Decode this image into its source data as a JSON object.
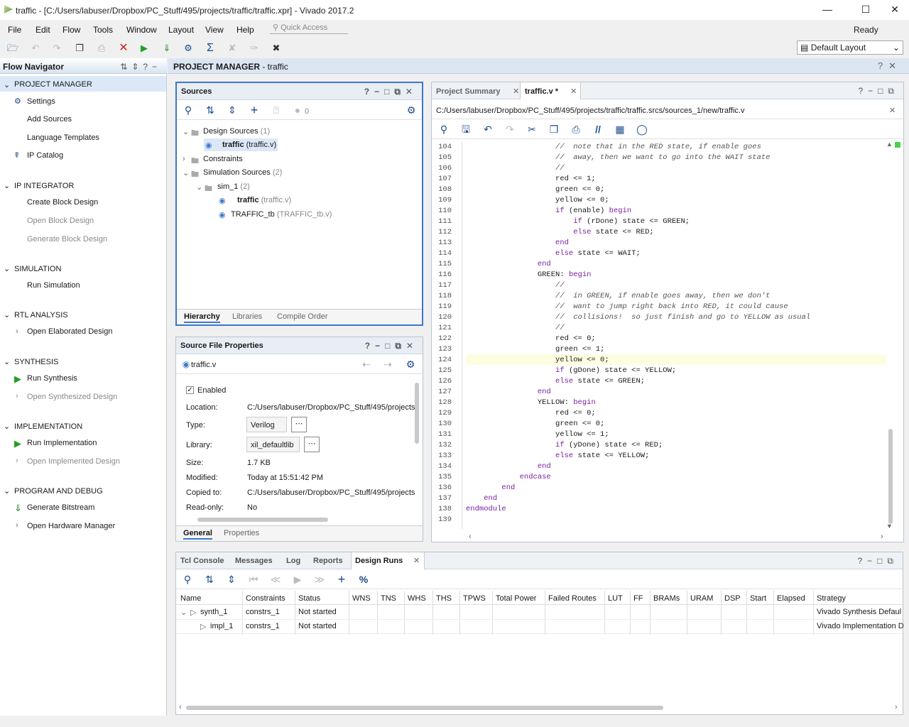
{
  "window": {
    "title": "traffic - [C:/Users/labuser/Dropbox/PC_Stuff/495/projects/traffic/traffic.xpr] - Vivado 2017.2"
  },
  "menu": [
    "File",
    "Edit",
    "Flow",
    "Tools",
    "Window",
    "Layout",
    "View",
    "Help"
  ],
  "quick_access": "Quick Access",
  "status": "Ready",
  "layout_select": "Default Layout",
  "flow_navigator": {
    "title": "Flow Navigator",
    "sections": [
      {
        "label": "PROJECT MANAGER",
        "items": [
          "Settings",
          "Add Sources",
          "Language Templates",
          "IP Catalog"
        ]
      },
      {
        "label": "IP INTEGRATOR",
        "items": [
          "Create Block Design",
          "Open Block Design",
          "Generate Block Design"
        ]
      },
      {
        "label": "SIMULATION",
        "items": [
          "Run Simulation"
        ]
      },
      {
        "label": "RTL ANALYSIS",
        "items": [
          "Open Elaborated Design"
        ]
      },
      {
        "label": "SYNTHESIS",
        "items": [
          "Run Synthesis",
          "Open Synthesized Design"
        ]
      },
      {
        "label": "IMPLEMENTATION",
        "items": [
          "Run Implementation",
          "Open Implemented Design"
        ]
      },
      {
        "label": "PROGRAM AND DEBUG",
        "items": [
          "Generate Bitstream",
          "Open Hardware Manager"
        ]
      }
    ]
  },
  "pm_bar": {
    "bold": "PROJECT MANAGER",
    "rest": " - traffic"
  },
  "sources": {
    "title": "Sources",
    "count": "0",
    "tree": [
      {
        "label": "Design Sources",
        "extra": "(1)"
      },
      {
        "label": "traffic",
        "extra": "(traffic.v)"
      },
      {
        "label": "Constraints",
        "extra": ""
      },
      {
        "label": "Simulation Sources",
        "extra": "(2)"
      },
      {
        "label": "sim_1",
        "extra": "(2)"
      },
      {
        "label": "traffic",
        "extra": "(traffic.v)"
      },
      {
        "label": "TRAFFIC_tb",
        "extra": "(TRAFFIC_tb.v)"
      }
    ],
    "tabs": [
      "Hierarchy",
      "Libraries",
      "Compile Order"
    ]
  },
  "props": {
    "title": "Source File Properties",
    "file": "traffic.v",
    "enabled": "Enabled",
    "fields": [
      {
        "k": "Location:",
        "v": "C:/Users/labuser/Dropbox/PC_Stuff/495/projects"
      },
      {
        "k": "Type:",
        "v": "Verilog"
      },
      {
        "k": "Library:",
        "v": "xil_defaultlib"
      },
      {
        "k": "Size:",
        "v": "1.7 KB"
      },
      {
        "k": "Modified:",
        "v": "Today at 15:51:42 PM"
      },
      {
        "k": "Copied to:",
        "v": "C:/Users/labuser/Dropbox/PC_Stuff/495/projects"
      },
      {
        "k": "Read-only:",
        "v": "No"
      }
    ],
    "tabs": [
      "General",
      "Properties"
    ]
  },
  "editor": {
    "tabs": [
      "Project Summary",
      "traffic.v *"
    ],
    "path": "C:/Users/labuser/Dropbox/PC_Stuff/495/projects/traffic/traffic.srcs/sources_1/new/traffic.v",
    "lines": [
      {
        "n": "104",
        "t": "                    //  note that in the RED state, if enable goes"
      },
      {
        "n": "105",
        "t": "                    //  away, then we want to go into the WAIT state"
      },
      {
        "n": "106",
        "t": "                    //"
      },
      {
        "n": "107",
        "t": "                    red <= 1;"
      },
      {
        "n": "108",
        "t": "                    green <= 0;"
      },
      {
        "n": "109",
        "t": "                    yellow <= 0;"
      },
      {
        "n": "110",
        "t": "                    if (enable) begin"
      },
      {
        "n": "111",
        "t": "                        if (rDone) state <= GREEN;"
      },
      {
        "n": "112",
        "t": "                        else state <= RED;"
      },
      {
        "n": "113",
        "t": "                    end"
      },
      {
        "n": "114",
        "t": "                    else state <= WAIT;"
      },
      {
        "n": "115",
        "t": "                end"
      },
      {
        "n": "116",
        "t": "                GREEN: begin"
      },
      {
        "n": "117",
        "t": "                    //"
      },
      {
        "n": "118",
        "t": "                    //  in GREEN, if enable goes away, then we don't"
      },
      {
        "n": "119",
        "t": "                    //  want to jump right back into RED, it could cause"
      },
      {
        "n": "120",
        "t": "                    //  collisions!  so just finish and go to YELLOW as usual"
      },
      {
        "n": "121",
        "t": "                    //"
      },
      {
        "n": "122",
        "t": "                    red <= 0;"
      },
      {
        "n": "123",
        "t": "                    green <= 1;"
      },
      {
        "n": "124",
        "t": "                    yellow <= 0;"
      },
      {
        "n": "125",
        "t": "                    if (gDone) state <= YELLOW;"
      },
      {
        "n": "126",
        "t": "                    else state <= GREEN;"
      },
      {
        "n": "127",
        "t": "                end"
      },
      {
        "n": "128",
        "t": "                YELLOW: begin"
      },
      {
        "n": "129",
        "t": "                    red <= 0;"
      },
      {
        "n": "130",
        "t": "                    green <= 0;"
      },
      {
        "n": "131",
        "t": "                    yellow <= 1;"
      },
      {
        "n": "132",
        "t": "                    if (yDone) state <= RED;"
      },
      {
        "n": "133",
        "t": "                    else state <= YELLOW;"
      },
      {
        "n": "134",
        "t": "                end"
      },
      {
        "n": "135",
        "t": "            endcase"
      },
      {
        "n": "136",
        "t": "        end"
      },
      {
        "n": "137",
        "t": "    end"
      },
      {
        "n": "138",
        "t": "endmodule"
      },
      {
        "n": "139",
        "t": ""
      }
    ]
  },
  "bottom": {
    "tabs": [
      "Tcl Console",
      "Messages",
      "Log",
      "Reports",
      "Design Runs"
    ],
    "columns": [
      "Name",
      "Constraints",
      "Status",
      "WNS",
      "TNS",
      "WHS",
      "THS",
      "TPWS",
      "Total Power",
      "Failed Routes",
      "LUT",
      "FF",
      "BRAMs",
      "URAM",
      "DSP",
      "Start",
      "Elapsed",
      "Strategy"
    ],
    "rows": [
      {
        "name": "synth_1",
        "constraints": "constrs_1",
        "status": "Not started",
        "strategy": "Vivado Synthesis Defaul"
      },
      {
        "name": "impl_1",
        "constraints": "constrs_1",
        "status": "Not started",
        "strategy": "Vivado Implementation D"
      }
    ]
  },
  "colors": {
    "accent": "#3c78c8",
    "selected_row": "#dce8f8",
    "highlight_line": "#fffde0",
    "keyword": "#7a1fa2"
  }
}
